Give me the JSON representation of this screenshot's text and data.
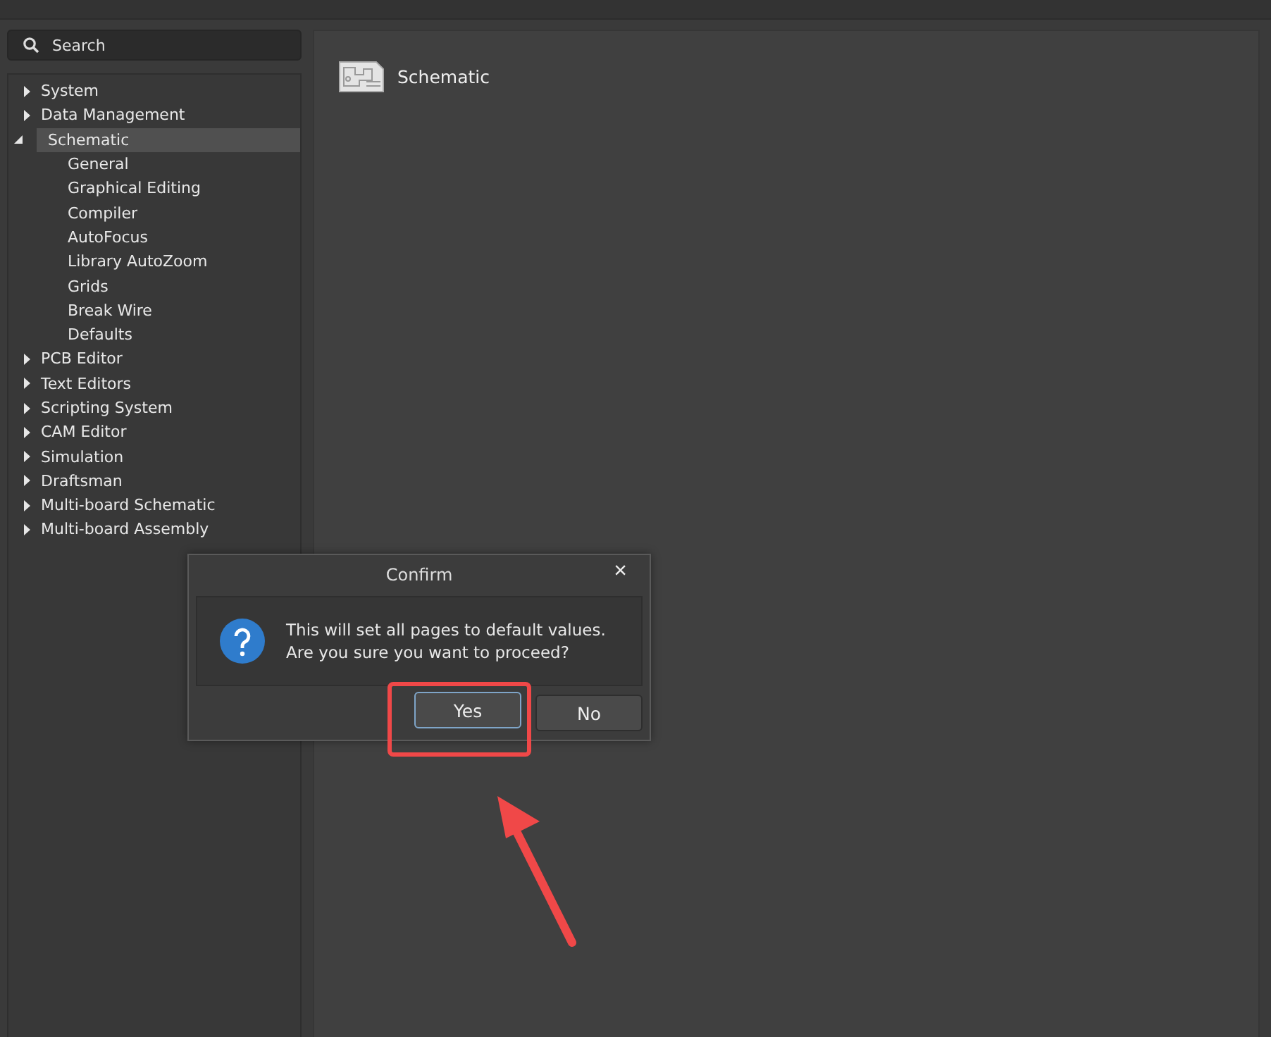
{
  "search": {
    "placeholder": "Search"
  },
  "tree": [
    {
      "label": "System",
      "expanded": false,
      "selected": false
    },
    {
      "label": "Data Management",
      "expanded": false,
      "selected": false
    },
    {
      "label": "Schematic",
      "expanded": true,
      "selected": true,
      "children": [
        {
          "label": "General",
          "selected": false
        },
        {
          "label": "Graphical Editing",
          "selected": false
        },
        {
          "label": "Compiler",
          "selected": false
        },
        {
          "label": "AutoFocus",
          "selected": false
        },
        {
          "label": "Library AutoZoom",
          "selected": false
        },
        {
          "label": "Grids",
          "selected": false
        },
        {
          "label": "Break Wire",
          "selected": false
        },
        {
          "label": "Defaults",
          "selected": false
        }
      ]
    },
    {
      "label": "PCB Editor",
      "expanded": false,
      "selected": false
    },
    {
      "label": "Text Editors",
      "expanded": false,
      "selected": false
    },
    {
      "label": "Scripting System",
      "expanded": false,
      "selected": false
    },
    {
      "label": "CAM Editor",
      "expanded": false,
      "selected": false
    },
    {
      "label": "Simulation",
      "expanded": false,
      "selected": false
    },
    {
      "label": "Draftsman",
      "expanded": false,
      "selected": false
    },
    {
      "label": "Multi-board Schematic",
      "expanded": false,
      "selected": false
    },
    {
      "label": "Multi-board Assembly",
      "expanded": false,
      "selected": false
    }
  ],
  "page": {
    "title": "Schematic"
  },
  "dialog": {
    "title": "Confirm",
    "close": "×",
    "message": [
      "This will set all pages to default values.",
      "Are you sure you want to proceed?"
    ],
    "buttons": [
      {
        "label": "Yes",
        "focused": true,
        "highlighted": true
      },
      {
        "label": "No",
        "focused": false,
        "highlighted": false
      }
    ]
  }
}
